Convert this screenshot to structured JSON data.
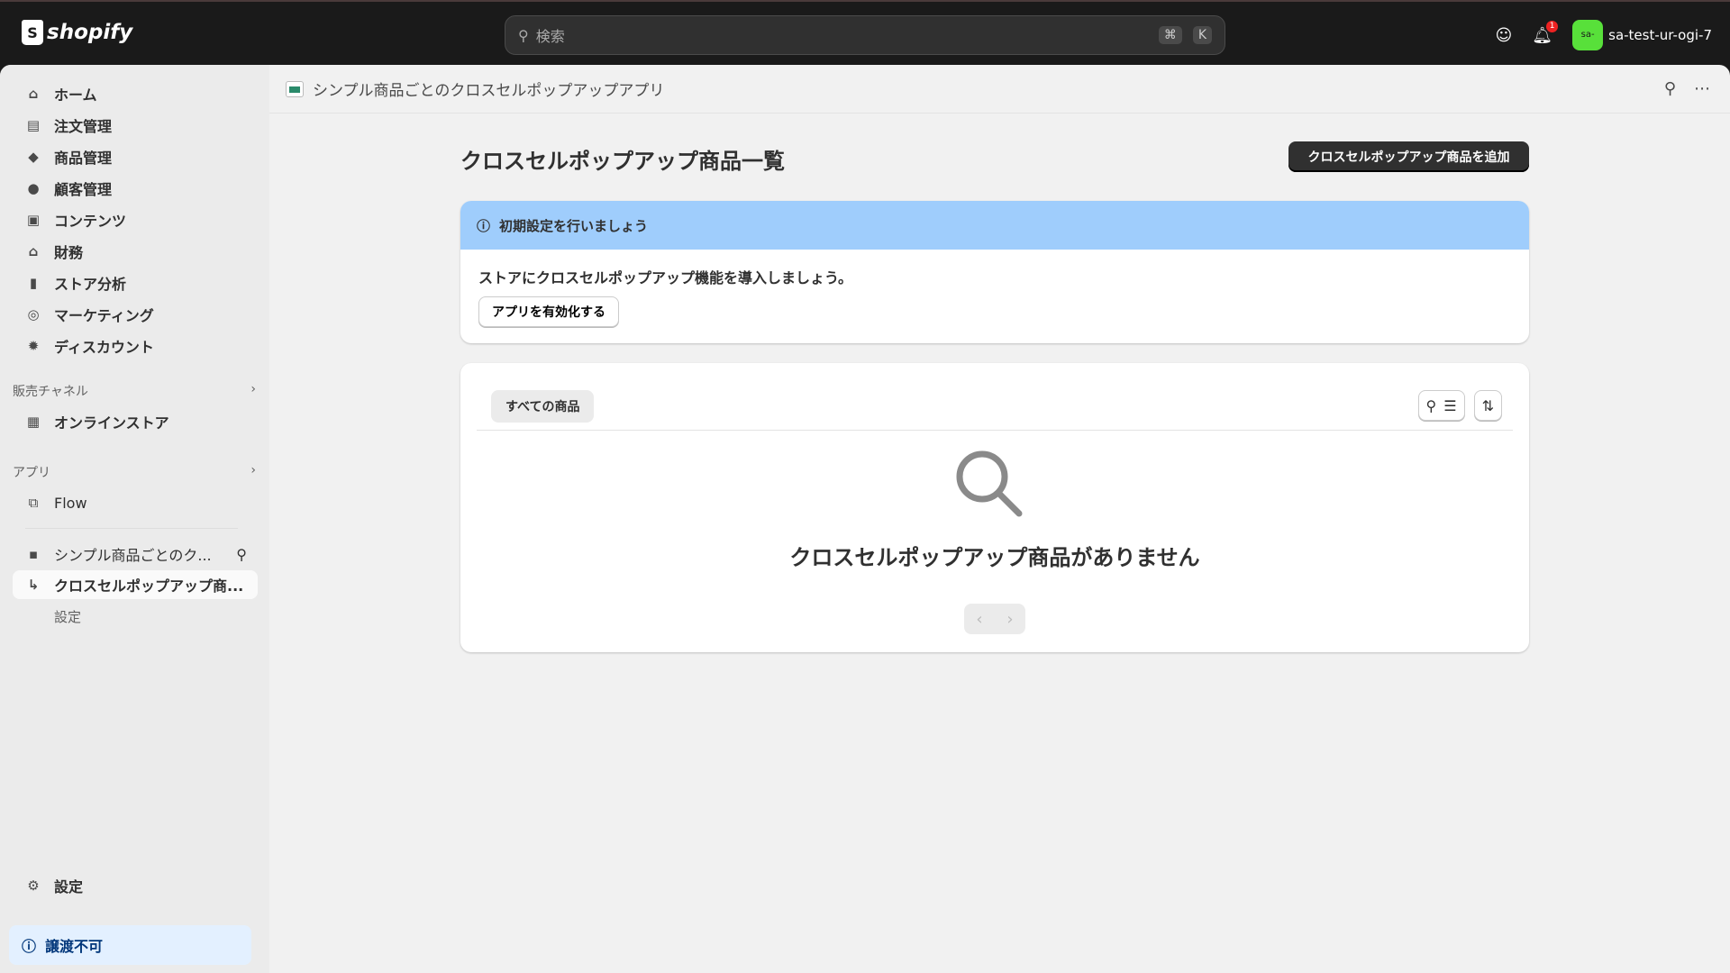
{
  "topbar": {
    "brand": "shopify",
    "search_placeholder": "検索",
    "shortcut_cmd": "⌘",
    "shortcut_key": "K",
    "notification_count": "1",
    "avatar_initials": "sa-",
    "store_name": "sa-test-ur-ogi-7"
  },
  "sidebar": {
    "items": [
      {
        "label": "ホーム",
        "icon": "⌂"
      },
      {
        "label": "注文管理",
        "icon": "▤"
      },
      {
        "label": "商品管理",
        "icon": "◆"
      },
      {
        "label": "顧客管理",
        "icon": "●"
      },
      {
        "label": "コンテンツ",
        "icon": "▣"
      },
      {
        "label": "財務",
        "icon": "⌂"
      },
      {
        "label": "ストア分析",
        "icon": "▮"
      },
      {
        "label": "マーケティング",
        "icon": "◎"
      },
      {
        "label": "ディスカウント",
        "icon": "✹"
      }
    ],
    "sales_channels_label": "販売チャネル",
    "online_store": "オンラインストア",
    "apps_label": "アプリ",
    "flow": "Flow",
    "app_name": "シンプル商品ごとのク...",
    "app_sub_active": "クロスセルポップアップ商...",
    "app_sub_settings": "設定",
    "settings": "設定",
    "non_transferable": "譲渡不可"
  },
  "breadcrumb": {
    "app_title": "シンプル商品ごとのクロスセルポップアップアプリ"
  },
  "page": {
    "title": "クロスセルポップアップ商品一覧",
    "add_button": "クロスセルポップアップ商品を追加"
  },
  "banner": {
    "title": "初期設定を行いましょう",
    "text": "ストアにクロスセルポップアップ機能を導入しましょう。",
    "button": "アプリを有効化する"
  },
  "list": {
    "tab": "すべての商品",
    "empty_text": "クロスセルポップアップ商品がありません"
  },
  "colors": {
    "banner": "#9fcdfc",
    "primary": "#303030",
    "avatar": "#58e03a"
  }
}
